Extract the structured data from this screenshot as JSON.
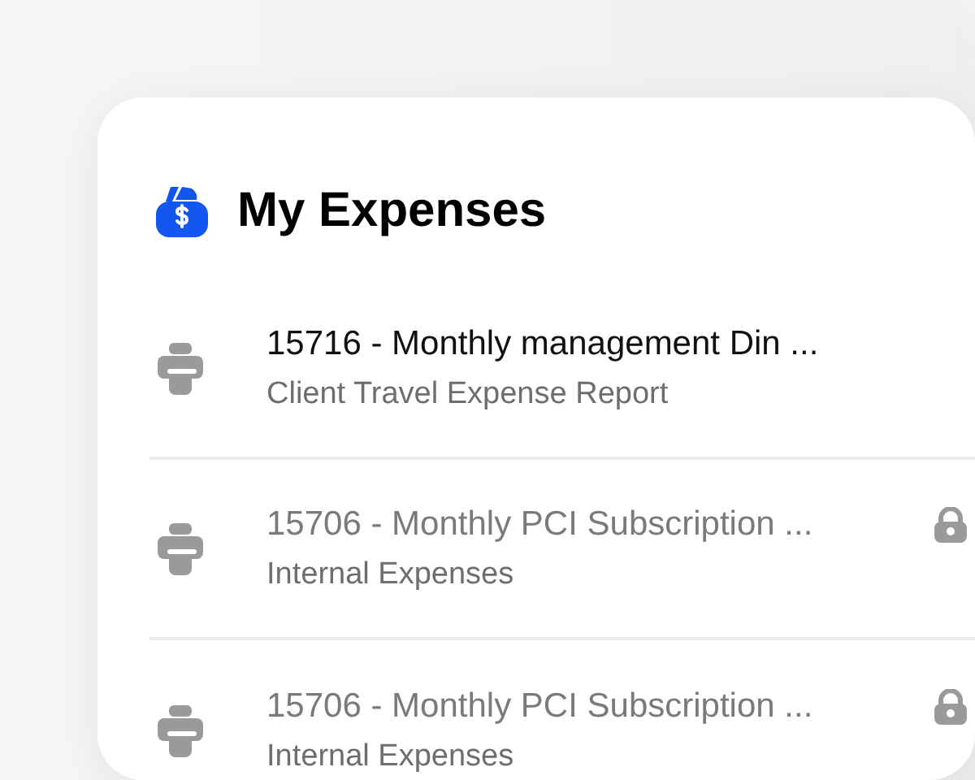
{
  "title": "My Expenses",
  "expenses": [
    {
      "title": "15716 - Monthly management Din ...",
      "subtitle": "Client Travel Expense Report",
      "locked": false
    },
    {
      "title": "15706 - Monthly PCI Subscription ...",
      "subtitle": "Internal Expenses",
      "locked": true
    },
    {
      "title": "15706 - Monthly PCI Subscription ...",
      "subtitle": "Internal Expenses",
      "locked": true
    }
  ]
}
